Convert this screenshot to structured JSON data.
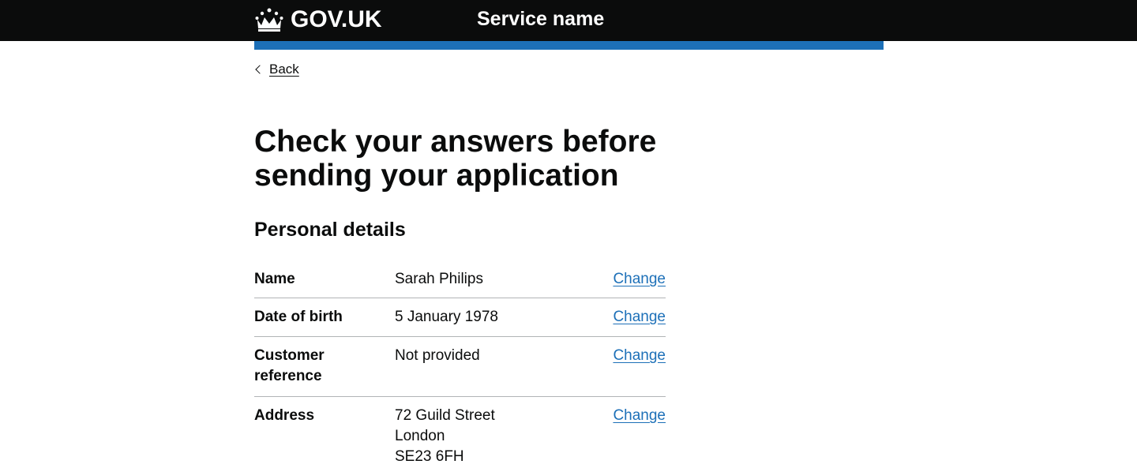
{
  "header": {
    "logo_text": "GOV.UK",
    "service_name": "Service name"
  },
  "nav": {
    "back_label": "Back"
  },
  "main": {
    "title": "Check your answers before sending your application",
    "section_title": "Personal details",
    "rows": [
      {
        "key": "Name",
        "value_lines": [
          "Sarah Philips"
        ],
        "action": "Change"
      },
      {
        "key": "Date of birth",
        "value_lines": [
          "5 January 1978"
        ],
        "action": "Change"
      },
      {
        "key": "Customer reference",
        "value_lines": [
          "Not provided"
        ],
        "action": "Change"
      },
      {
        "key": "Address",
        "value_lines": [
          "72 Guild Street",
          "London",
          "SE23 6FH"
        ],
        "action": "Change"
      }
    ]
  },
  "colors": {
    "header_bg": "#0b0c0c",
    "accent_blue": "#1d70b8",
    "link": "#1d70b8",
    "divider": "#b1b4b6"
  }
}
